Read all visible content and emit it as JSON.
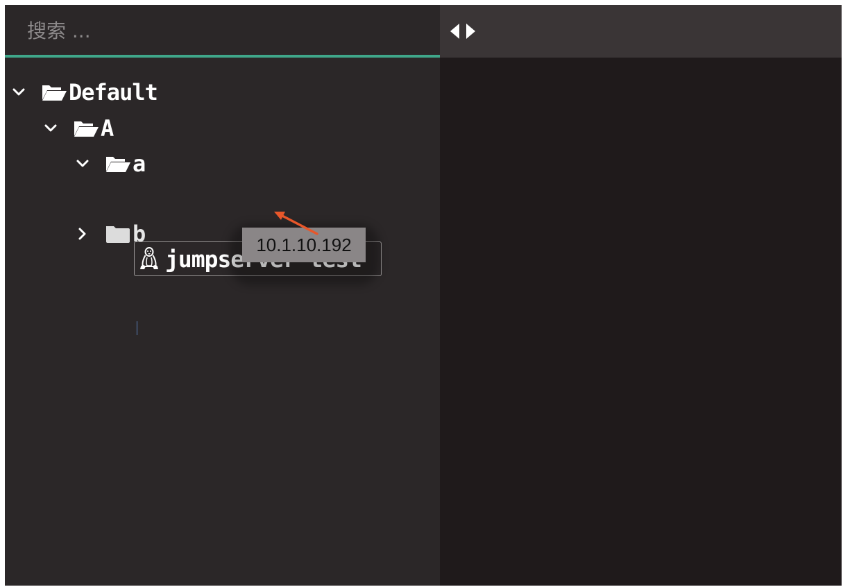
{
  "search": {
    "placeholder": "搜索 ..."
  },
  "tree": {
    "nodes": [
      {
        "label": "Default",
        "expanded": true,
        "icon": "folder-open-icon"
      },
      {
        "label": "A",
        "expanded": true,
        "icon": "folder-open-icon"
      },
      {
        "label": "a",
        "expanded": true,
        "icon": "folder-open-icon"
      },
      {
        "label": "jumpserver-test",
        "icon": "linux-icon",
        "selected": true
      },
      {
        "label": "b",
        "expanded": false,
        "icon": "folder-closed-icon"
      }
    ]
  },
  "tooltip": {
    "text": "10.1.10.192"
  },
  "right_panel": {
    "toggle_icon": "collapse-expand-arrows-icon"
  },
  "colors": {
    "panel_bg": "#2b2728",
    "terminal_bg": "#1f1a1b",
    "header_bg": "#3a3536",
    "accent": "#3fa78a",
    "annotation_arrow": "#e8572a"
  }
}
